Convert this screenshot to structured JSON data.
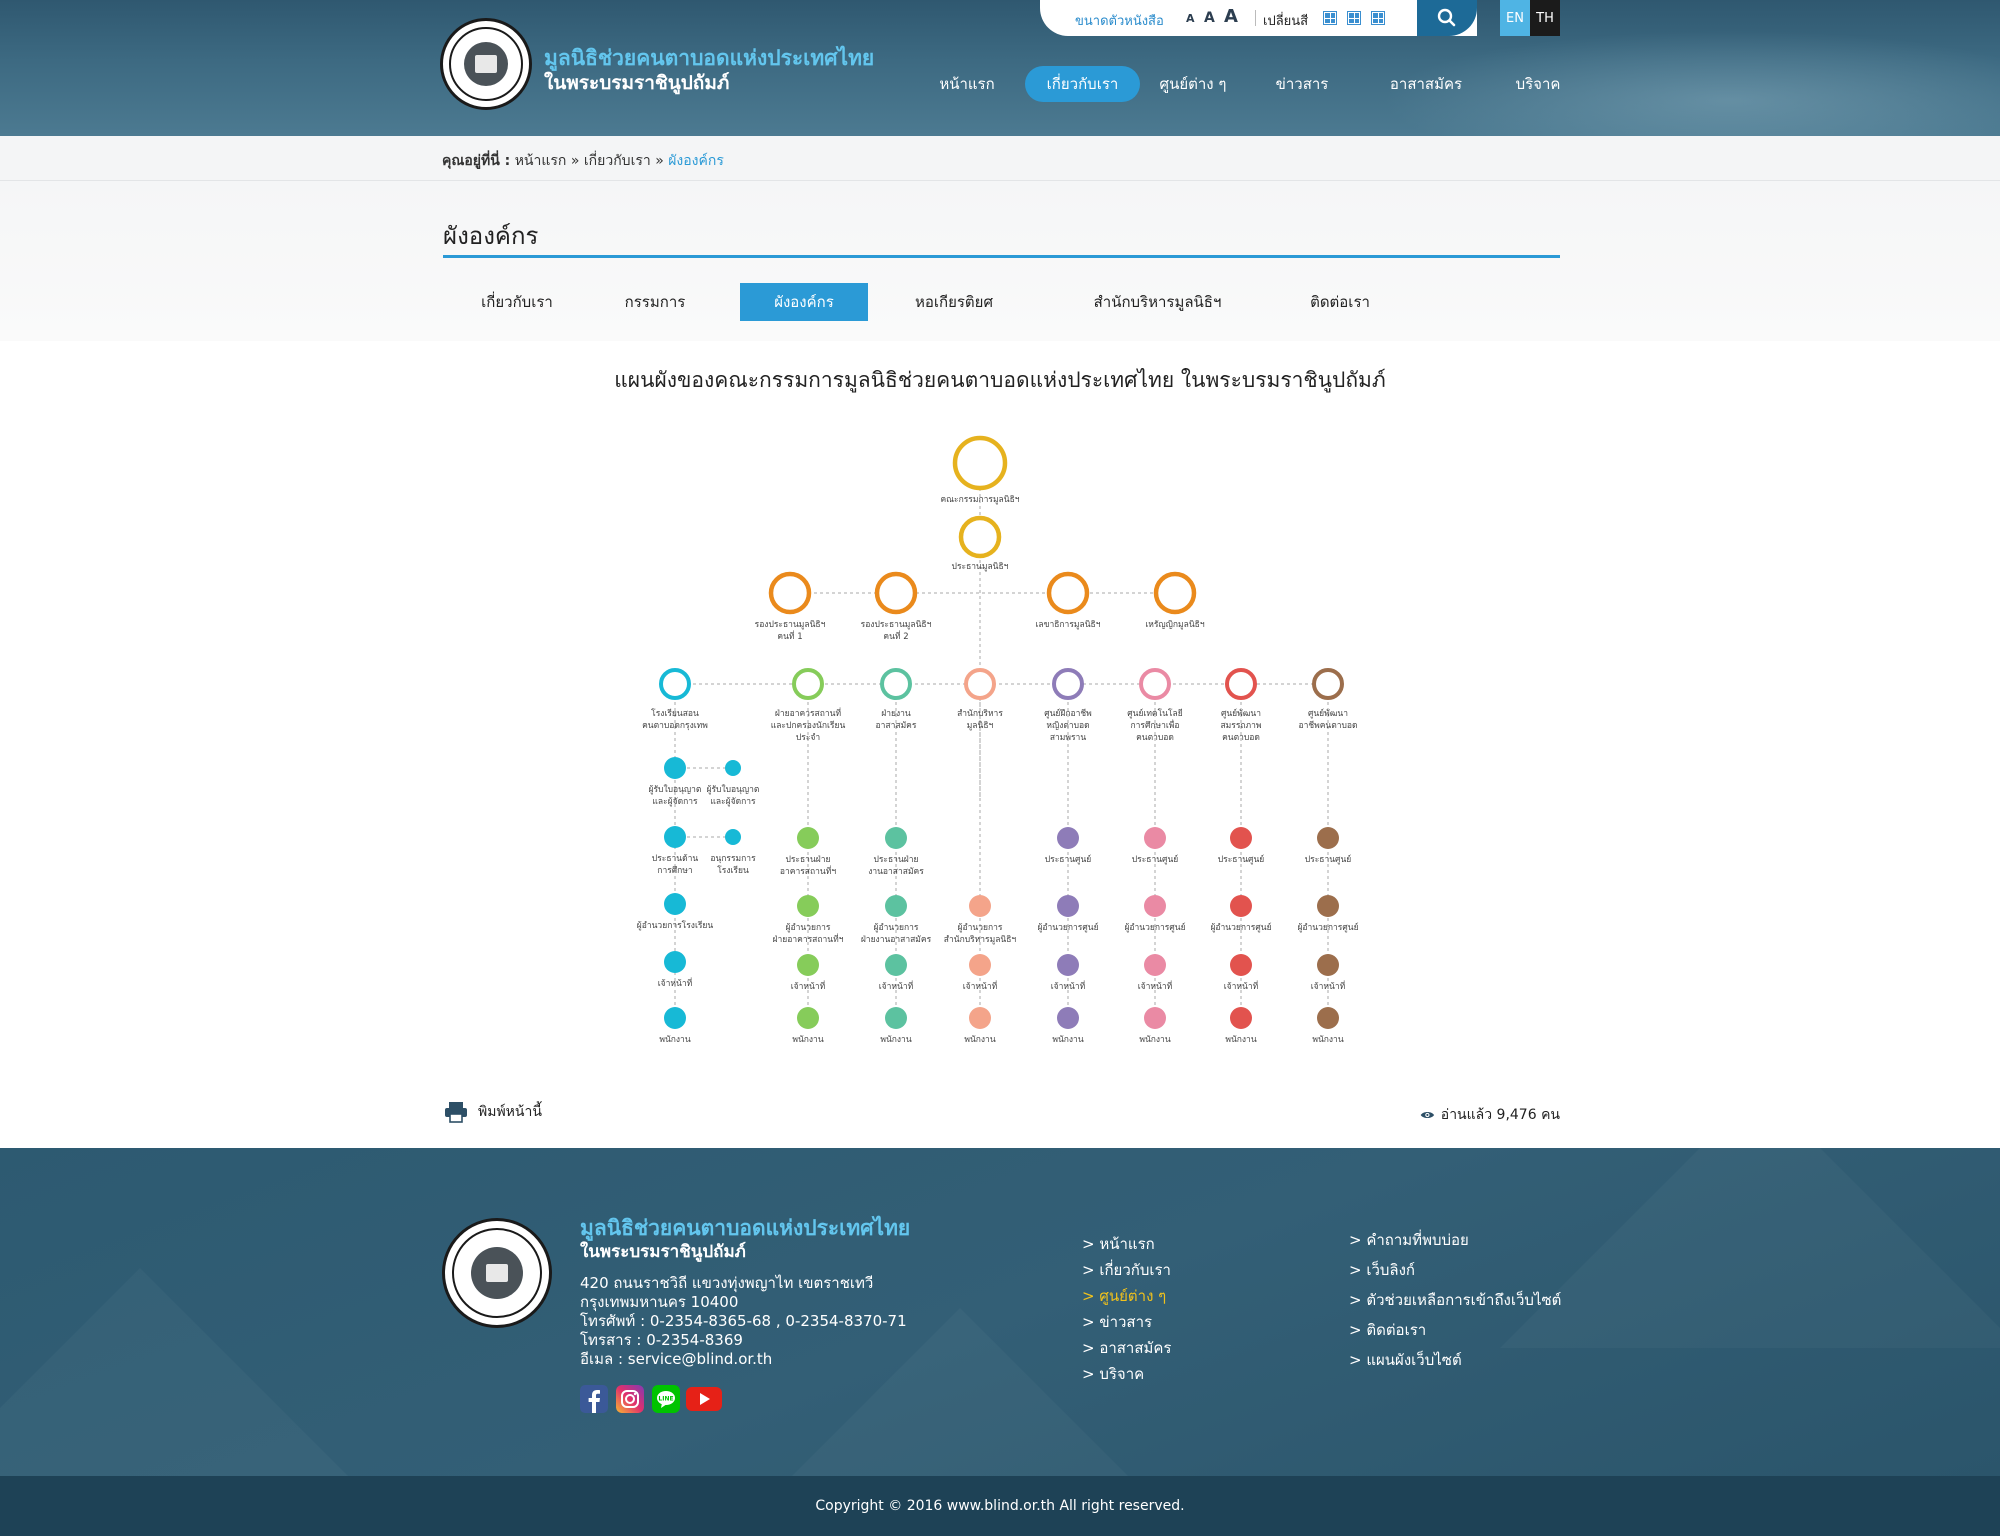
{
  "header": {
    "site_title": "มูลนิธิช่วยคนตาบอดแห่งประเทศไทย",
    "site_subtitle": "ในพระบรมราชินูปถัมภ์",
    "font_size_label": "ขนาดตัวหนังสือ",
    "font_sizes": [
      "A",
      "A",
      "A"
    ],
    "color_scheme_label": "เปลี่ยนสี",
    "lang_en": "EN",
    "lang_th": "TH",
    "nav": [
      "หน้าแรก",
      "เกี่ยวกับเรา",
      "ศูนย์ต่าง ๆ",
      "ข่าวสาร",
      "อาสาสมัคร",
      "บริจาค"
    ],
    "nav_active": "เกี่ยวกับเรา"
  },
  "breadcrumb": {
    "here_label": "คุณอยู่ที่นี่ :",
    "items": [
      "หน้าแรก",
      "เกี่ยวกับเรา",
      "ผังองค์กร"
    ],
    "separator": "»"
  },
  "page": {
    "title": "ผังองค์กร",
    "subtabs": [
      "เกี่ยวกับเรา",
      "กรรมการ",
      "ผังองค์กร",
      "หอเกียรติยศ",
      "สำนักบริหารมูลนิธิฯ",
      "ติดต่อเรา"
    ],
    "subtab_active": "ผังองค์กร",
    "chart_title": "แผนผังของคณะกรรมการมูลนิธิช่วยคนตาบอดแห่งประเทศไทย ในพระบรมราชินูปถัมภ์",
    "print_label": "พิมพ์หน้านี้",
    "read_count": "อ่านแล้ว 9,476 คน"
  },
  "org_chart": {
    "colors": {
      "top": "#e6b21e",
      "vp": "#ea8a1c",
      "cyan": "#17b9d6",
      "green": "#86cc5a",
      "teal": "#5cc2a0",
      "peach": "#f4a48a",
      "purple": "#8e7cb8",
      "pink": "#ea8aa4",
      "red": "#e2534e",
      "brown": "#9c6e4c"
    },
    "board": "คณะกรรมการมูลนิธิฯ",
    "president": "ประธานมูลนิธิฯ",
    "level2": [
      "รองประธานมูลนิธิฯ|คนที่ 1",
      "รองประธานมูลนิธิฯ|คนที่ 2",
      "เลขาธิการมูลนิธิฯ",
      "เหรัญญิกมูลนิธิฯ"
    ],
    "departments": [
      {
        "color": "cyan",
        "label": "โรงเรียนสอน|คนตาบอดกรุงเทพ",
        "side_nodes": [
          [
            "ผู้รับใบอนุญาต|และผู้จัดการ",
            "ผู้รับใบอนุญาต|และผู้จัดการ"
          ],
          [
            "ประธานด้าน|การศึกษา",
            "อนุกรรมการ|โรงเรียน"
          ]
        ],
        "chain": [
          "ผู้อำนวยการโรงเรียน",
          "เจ้าหน้าที่",
          "พนักงาน"
        ]
      },
      {
        "color": "green",
        "label": "ฝ่ายอาคารสถานที่|และปกครองนักเรียน|ประจำ",
        "chain": [
          "ประธานฝ่าย|อาคารสถานที่ฯ",
          "ผู้อำนวยการ|ฝ่ายอาคารสถานที่ฯ",
          "เจ้าหน้าที่",
          "พนักงาน"
        ]
      },
      {
        "color": "teal",
        "label": "ฝ่ายงาน|อาสาสมัคร",
        "chain": [
          "ประธานฝ่าย|งานอาสาสมัคร",
          "ผู้อำนวยการ|ฝ่ายงานอาสาสมัคร",
          "เจ้าหน้าที่",
          "พนักงาน"
        ]
      },
      {
        "color": "peach",
        "label": "สำนักบริหาร|มูลนิธิฯ",
        "chain": [
          "ผู้อำนวยการ|สำนักบริหารมูลนิธิฯ",
          "เจ้าหน้าที่",
          "พนักงาน"
        ]
      },
      {
        "color": "purple",
        "label": "ศูนย์ฝึกอาชีพ|หญิงตาบอด|สามพราน",
        "chain": [
          "ประธานศูนย์",
          "ผู้อำนวยการศูนย์",
          "เจ้าหน้าที่",
          "พนักงาน"
        ]
      },
      {
        "color": "pink",
        "label": "ศูนย์เทคโนโลยี|การศึกษาเพื่อ|คนตาบอด",
        "chain": [
          "ประธานศูนย์",
          "ผู้อำนวยการศูนย์",
          "เจ้าหน้าที่",
          "พนักงาน"
        ]
      },
      {
        "color": "red",
        "label": "ศูนย์พัฒนา|สมรรถภาพ|คนตาบอด",
        "chain": [
          "ประธานศูนย์",
          "ผู้อำนวยการศูนย์",
          "เจ้าหน้าที่",
          "พนักงาน"
        ]
      },
      {
        "color": "brown",
        "label": "ศูนย์พัฒนา|อาชีพคนตาบอด",
        "chain": [
          "ประธานศูนย์",
          "ผู้อำนวยการศูนย์",
          "เจ้าหน้าที่",
          "พนักงาน"
        ]
      }
    ]
  },
  "footer": {
    "title": "มูลนิธิช่วยคนตาบอดแห่งประเทศไทย",
    "subtitle": "ในพระบรมราชินูปถัมภ์",
    "address": [
      "420 ถนนราชวิถี แขวงทุ่งพญาไท เขตราชเทวี",
      "กรุงเทพมหานคร 10400",
      "โทรศัพท์ : 0-2354-8365-68 , 0-2354-8370-71",
      "โทรสาร : 0-2354-8369",
      "อีเมล : service@blind.or.th"
    ],
    "links_col1": [
      "> หน้าแรก",
      "> เกี่ยวกับเรา",
      "> ศูนย์ต่าง ๆ",
      "> ข่าวสาร",
      "> อาสาสมัคร",
      "> บริจาค"
    ],
    "links_col1_highlight": "> ศูนย์ต่าง ๆ",
    "links_col2": [
      "> คำถามที่พบบ่อย",
      "> เว็บลิงก์",
      "> ตัวช่วยเหลือการเข้าถึงเว็บไซต์",
      "> ติดต่อเรา",
      "> แผนผังเว็บไซต์"
    ],
    "social": [
      "facebook-icon",
      "instagram-icon",
      "line-icon",
      "youtube-icon"
    ],
    "copyright": "Copyright © 2016 www.blind.or.th All right reserved."
  }
}
